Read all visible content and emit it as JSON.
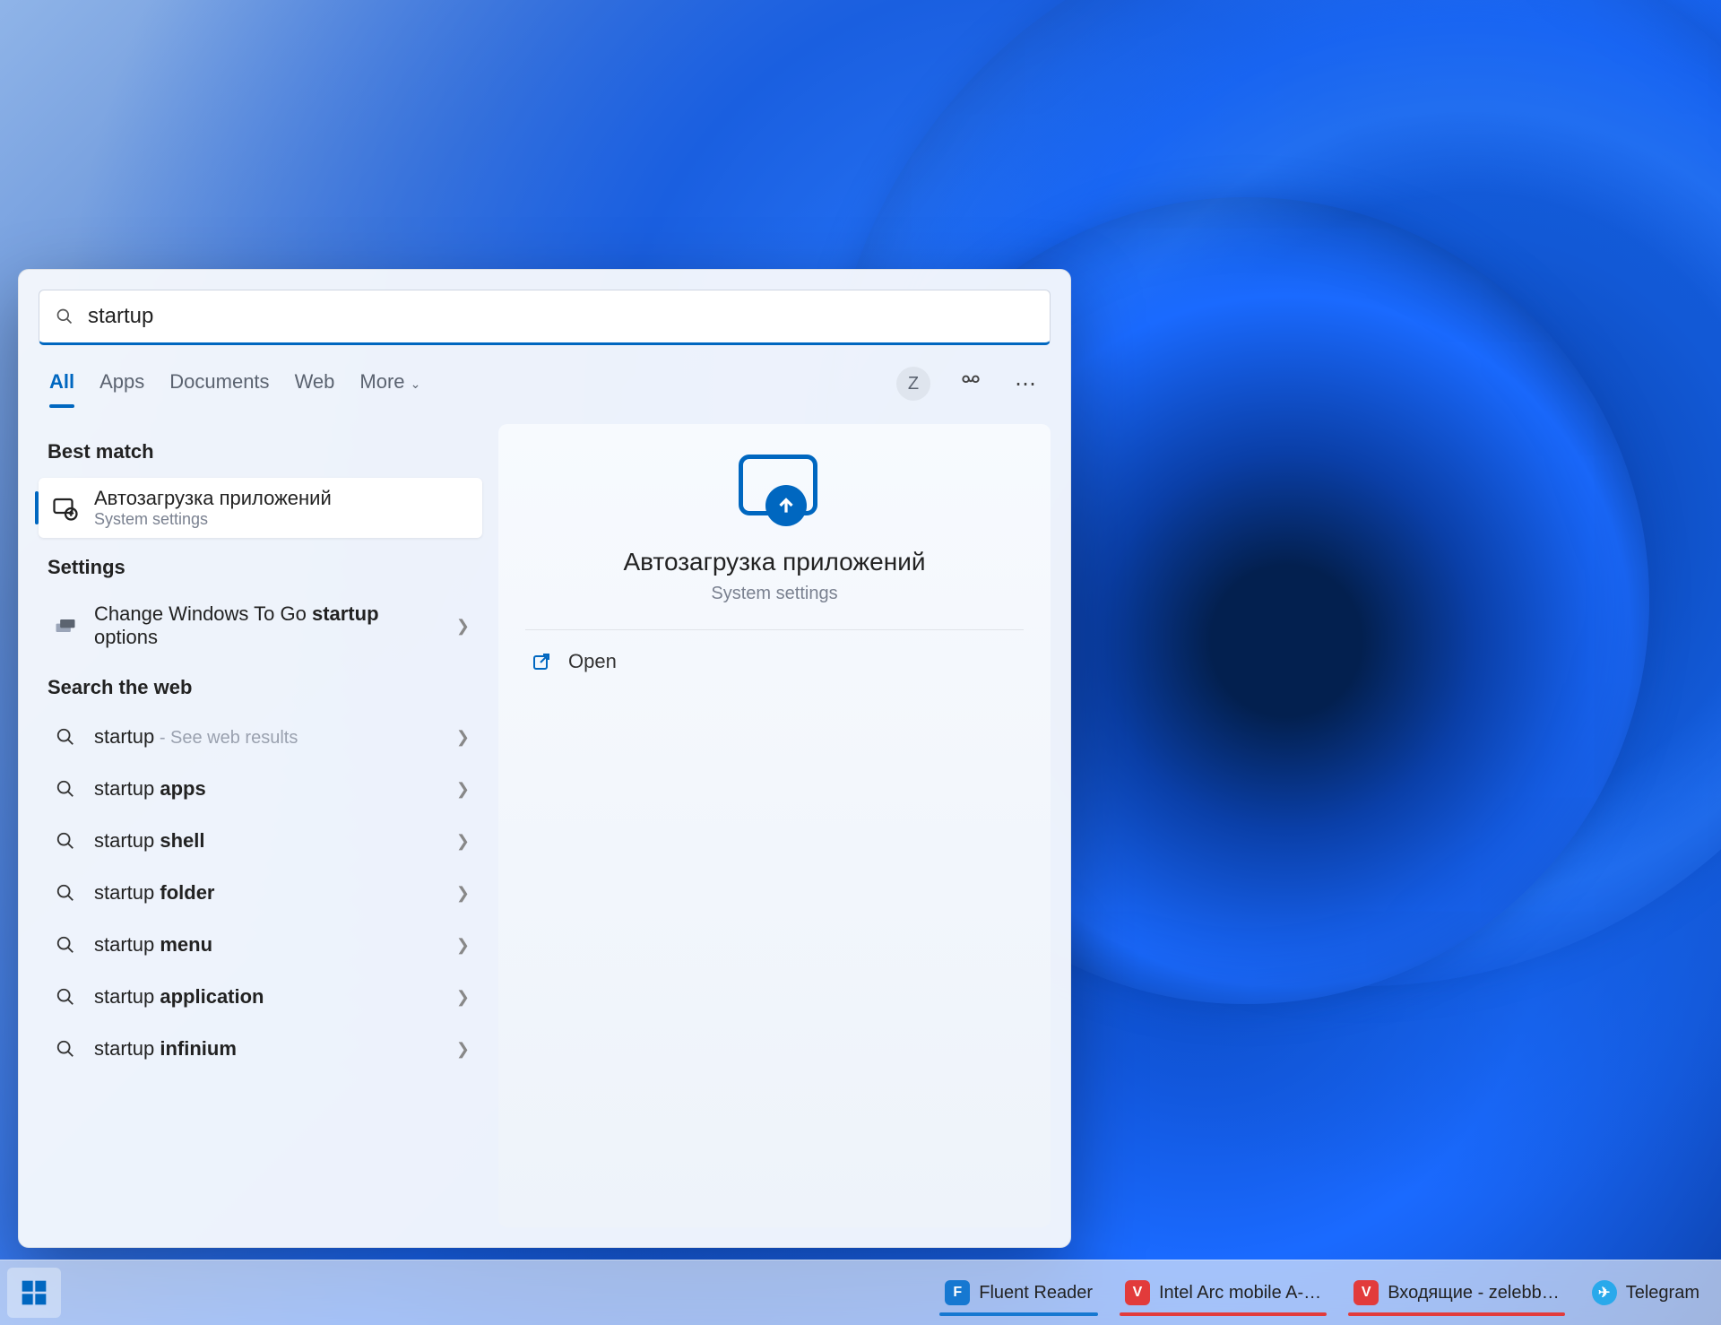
{
  "search": {
    "query": "startup"
  },
  "tabs": {
    "all": "All",
    "apps": "Apps",
    "documents": "Documents",
    "web": "Web",
    "more": "More"
  },
  "profile_initial": "Z",
  "sections": {
    "best_match": "Best match",
    "settings": "Settings",
    "web": "Search the web"
  },
  "best_match": {
    "title": "Автозагрузка приложений",
    "subtitle": "System settings"
  },
  "settings_results": [
    {
      "prefix": "Change Windows To Go ",
      "bold": "startup",
      "suffix": " options"
    }
  ],
  "web_results": [
    {
      "prefix": "startup",
      "bold": "",
      "hint": " - See web results"
    },
    {
      "prefix": "startup ",
      "bold": "apps",
      "hint": ""
    },
    {
      "prefix": "startup ",
      "bold": "shell",
      "hint": ""
    },
    {
      "prefix": "startup ",
      "bold": "folder",
      "hint": ""
    },
    {
      "prefix": "startup ",
      "bold": "menu",
      "hint": ""
    },
    {
      "prefix": "startup ",
      "bold": "application",
      "hint": ""
    },
    {
      "prefix": "startup ",
      "bold": "infinium",
      "hint": ""
    }
  ],
  "preview": {
    "title": "Автозагрузка приложений",
    "subtitle": "System settings",
    "open": "Open"
  },
  "taskbar": [
    {
      "label": "Fluent Reader",
      "icon_bg": "#1678d1",
      "icon_text": "F",
      "underline": "#1678d1"
    },
    {
      "label": "Intel Arc mobile A-…",
      "icon_bg": "#e23b3b",
      "icon_text": "V",
      "underline": "#e23b3b"
    },
    {
      "label": "Входящие - zelebb…",
      "icon_bg": "#e23b3b",
      "icon_text": "V",
      "underline": "#e23b3b"
    },
    {
      "label": "Telegram",
      "icon_bg": "#29a9eb",
      "icon_text": "✈",
      "underline": ""
    }
  ]
}
